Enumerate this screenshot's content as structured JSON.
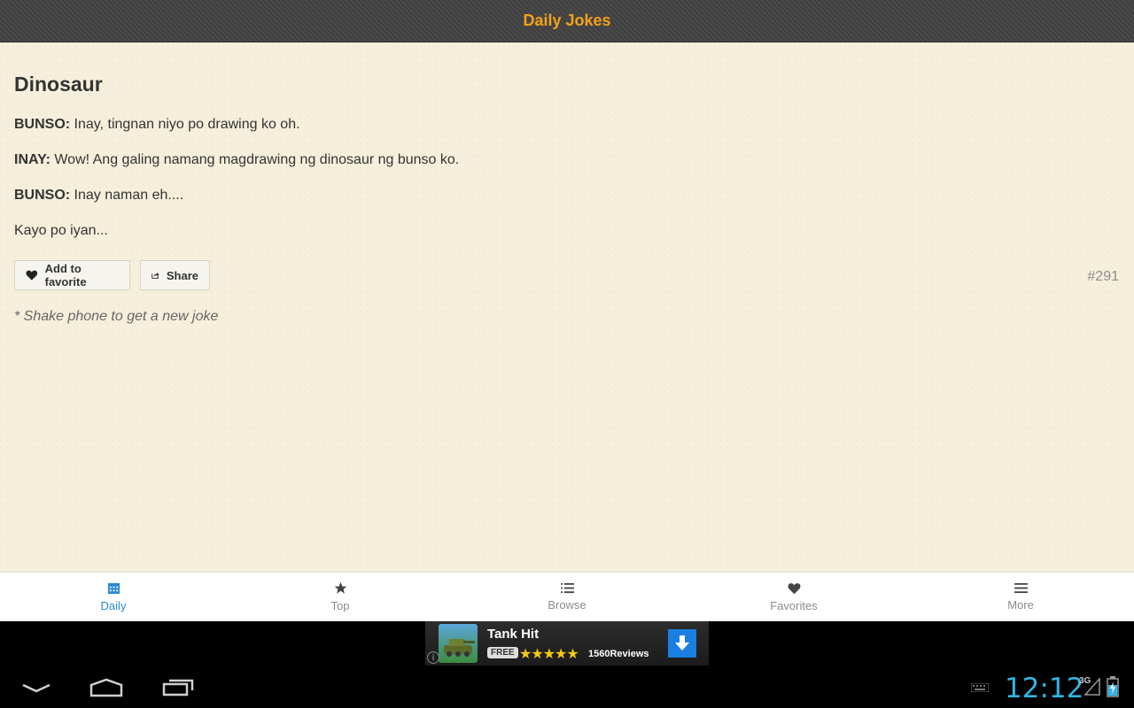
{
  "header": {
    "title": "Daily Jokes"
  },
  "joke": {
    "title": "Dinosaur",
    "lines": [
      {
        "speaker": "BUNSO:",
        "text": " Inay, tingnan niyo po drawing ko oh."
      },
      {
        "speaker": "INAY:",
        "text": " Wow! Ang galing namang magdrawing ng dinosaur ng bunso ko."
      },
      {
        "speaker": "BUNSO:",
        "text": " Inay naman eh...."
      },
      {
        "speaker": "",
        "text": "Kayo po iyan..."
      }
    ],
    "number": "#291",
    "hint": "* Shake phone to get a new joke"
  },
  "actions": {
    "favorite_label": "Add to favorite",
    "share_label": "Share"
  },
  "tabs": [
    {
      "label": "Daily",
      "icon": "calendar-icon",
      "active": true
    },
    {
      "label": "Top",
      "icon": "star-icon",
      "active": false
    },
    {
      "label": "Browse",
      "icon": "list-icon",
      "active": false
    },
    {
      "label": "Favorites",
      "icon": "heart-icon",
      "active": false
    },
    {
      "label": "More",
      "icon": "menu-icon",
      "active": false
    }
  ],
  "ad": {
    "title": "Tank Hit",
    "badge": "FREE",
    "stars": "★★★★★",
    "reviews": "1560Reviews",
    "info": "i"
  },
  "system": {
    "clock": "12:12",
    "network": "3G"
  },
  "colors": {
    "accent": "#f3a11c",
    "active_tab": "#2a8ad6",
    "clock": "#33b5e5"
  }
}
